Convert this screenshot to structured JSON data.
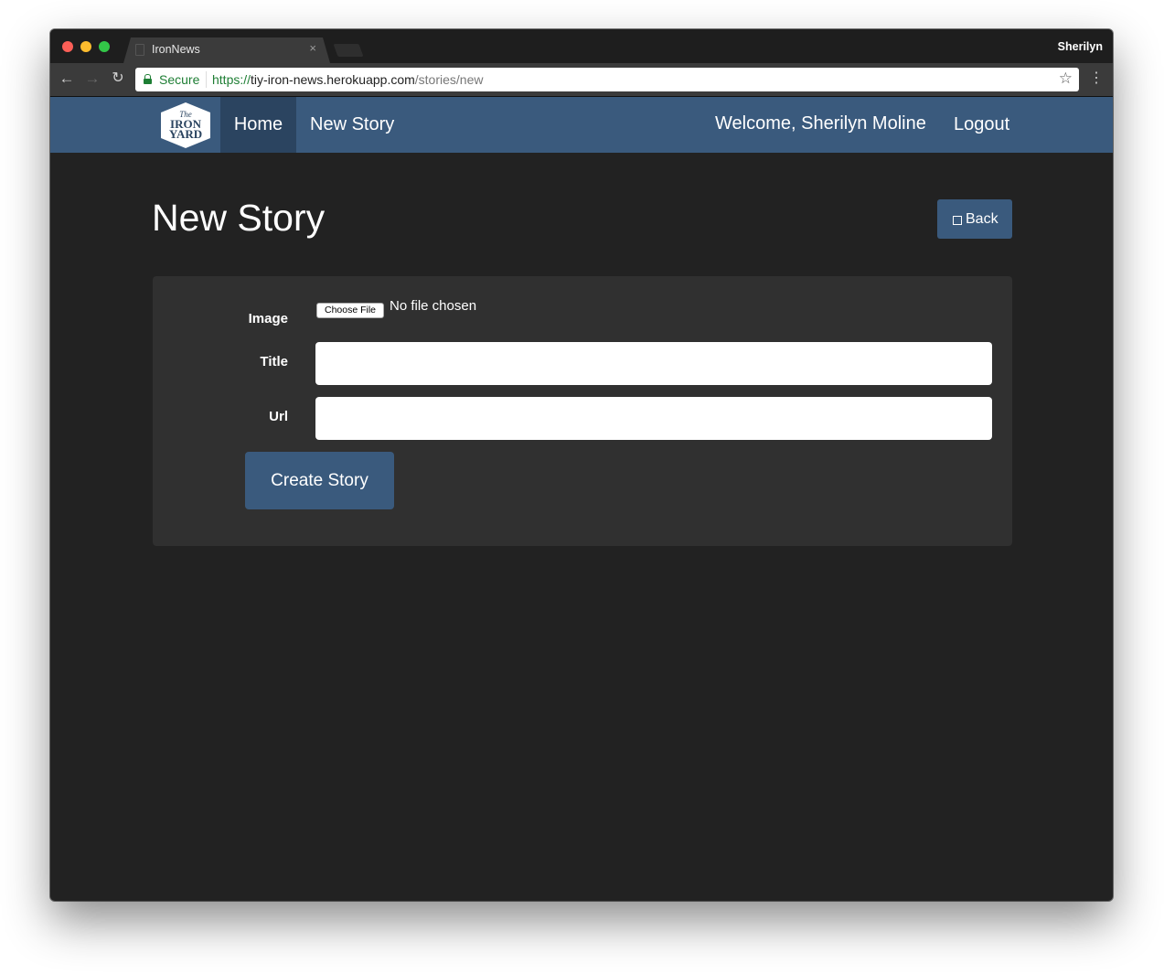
{
  "browser": {
    "tab_title": "IronNews",
    "tab_close": "×",
    "profile_name": "Sherilyn",
    "secure_label": "Secure",
    "url_scheme": "https://",
    "url_host": "tiy-iron-news.herokuapp.com",
    "url_path": "/stories/new",
    "icons": [
      "back-arrow-icon",
      "forward-arrow-icon",
      "reload-icon",
      "lock-icon",
      "star-icon",
      "kebab-menu-icon"
    ]
  },
  "navbar": {
    "logo_text": [
      "The",
      "IRON",
      "YARD"
    ],
    "home_label": "Home",
    "new_story_label": "New Story",
    "welcome_text": "Welcome, Sherilyn Moline",
    "logout_label": "Logout",
    "colors": {
      "bar": "#3a5a7d",
      "active": "#2b4460"
    }
  },
  "page": {
    "title": "New Story",
    "back_label": "Back"
  },
  "form": {
    "image_label": "Image",
    "choose_file_label": "Choose File",
    "no_file_text": "No file chosen",
    "title_label": "Title",
    "title_value": "",
    "url_label": "Url",
    "url_value": "",
    "submit_label": "Create Story"
  }
}
